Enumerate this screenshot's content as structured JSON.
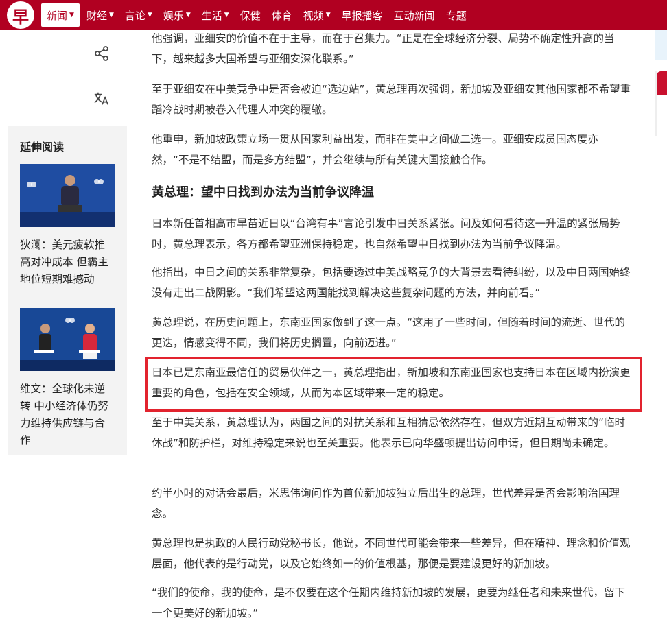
{
  "nav": {
    "logo": "早",
    "items": [
      {
        "label": "新闻",
        "dropdown": true,
        "active": true
      },
      {
        "label": "财经",
        "dropdown": true
      },
      {
        "label": "言论",
        "dropdown": true
      },
      {
        "label": "娱乐",
        "dropdown": true
      },
      {
        "label": "生活",
        "dropdown": true
      },
      {
        "label": "保健",
        "dropdown": false
      },
      {
        "label": "体育",
        "dropdown": false
      },
      {
        "label": "视频",
        "dropdown": true
      },
      {
        "label": "早报播客",
        "dropdown": false
      },
      {
        "label": "互动新闻",
        "dropdown": false
      },
      {
        "label": "专题",
        "dropdown": false
      }
    ]
  },
  "tools": {
    "share_icon": "share-icon",
    "translate_icon": "translate-icon"
  },
  "sidebar": {
    "title": "延伸阅读",
    "items": [
      {
        "title": "狄澜：美元疲软推高对冲成本 但霸主地位短期难撼动"
      },
      {
        "title": "维文：全球化未逆转 中小经济体仍努力维持供应链与合作"
      }
    ]
  },
  "article": {
    "paragraphs": [
      "他强调，亚细安的价值不在于主导，而在于召集力。“正是在全球经济分裂、局势不确定性升高的当下，越来越多大国希望与亚细安深化联系。”",
      "至于亚细安在中美竞争中是否会被迫“选边站”，黄总理再次强调，新加坡及亚细安其他国家都不希望重蹈冷战时期被卷入代理人冲突的覆辙。",
      "他重申，新加坡政策立场一贯从国家利益出发，而非在美中之间做二选一。亚细安成员国态度亦然，“不是不结盟，而是多方结盟”，并会继续与所有关键大国接触合作。",
      "日本新任首相高市早苗近日以“台湾有事”言论引发中日关系紧张。问及如何看待这一升温的紧张局势时，黄总理表示，各方都希望亚洲保持稳定，也自然希望中日找到办法为当前争议降温。",
      "他指出，中日之间的关系非常复杂，包括要透过中美战略竞争的大背景去看待纠纷，以及中日两国始终没有走出二战阴影。“我们希望这两国能找到解决这些复杂问题的方法，并向前看。”",
      "黄总理说，在历史问题上，东南亚国家做到了这一点。“这用了一些时间，但随着时间的流逝、世代的更迭，情感变得不同，我们将历史搁置，向前迈进。”",
      "日本已是东南亚最信任的贸易伙伴之一，黄总理指出，新加坡和东南亚国家也支持日本在区域内扮演更重要的角色，包括在安全领域，从而为本区域带来一定的稳定。",
      "至于中美关系，黄总理认为，两国之间的对抗关系和互相猜忌依然存在，但双方近期互动带来的“临时休战”和防护栏，对维持稳定来说也至关重要。他表示已向华盛顿提出访问申请，但日期尚未确定。",
      "约半小时的对话会最后，米思伟询问作为首位新加坡独立后出生的总理，世代差异是否会影响治国理念。",
      "黄总理也是执政的人民行动党秘书长，他说，不同世代可能会带来一些差异，但在精神、理念和价值观层面，他代表的是行动党，以及它始终如一的价值根基，那便是要建设更好的新加坡。",
      "“我们的使命，我的使命，是不仅要在这个任期内维持新加坡的发展，更要为继任者和未来世代，留下一个更美好的新加坡。”"
    ],
    "subheading": "黄总理：望中日找到办法为当前争议降温"
  },
  "colors": {
    "brand": "#b10021",
    "highlight": "#e2232e"
  }
}
